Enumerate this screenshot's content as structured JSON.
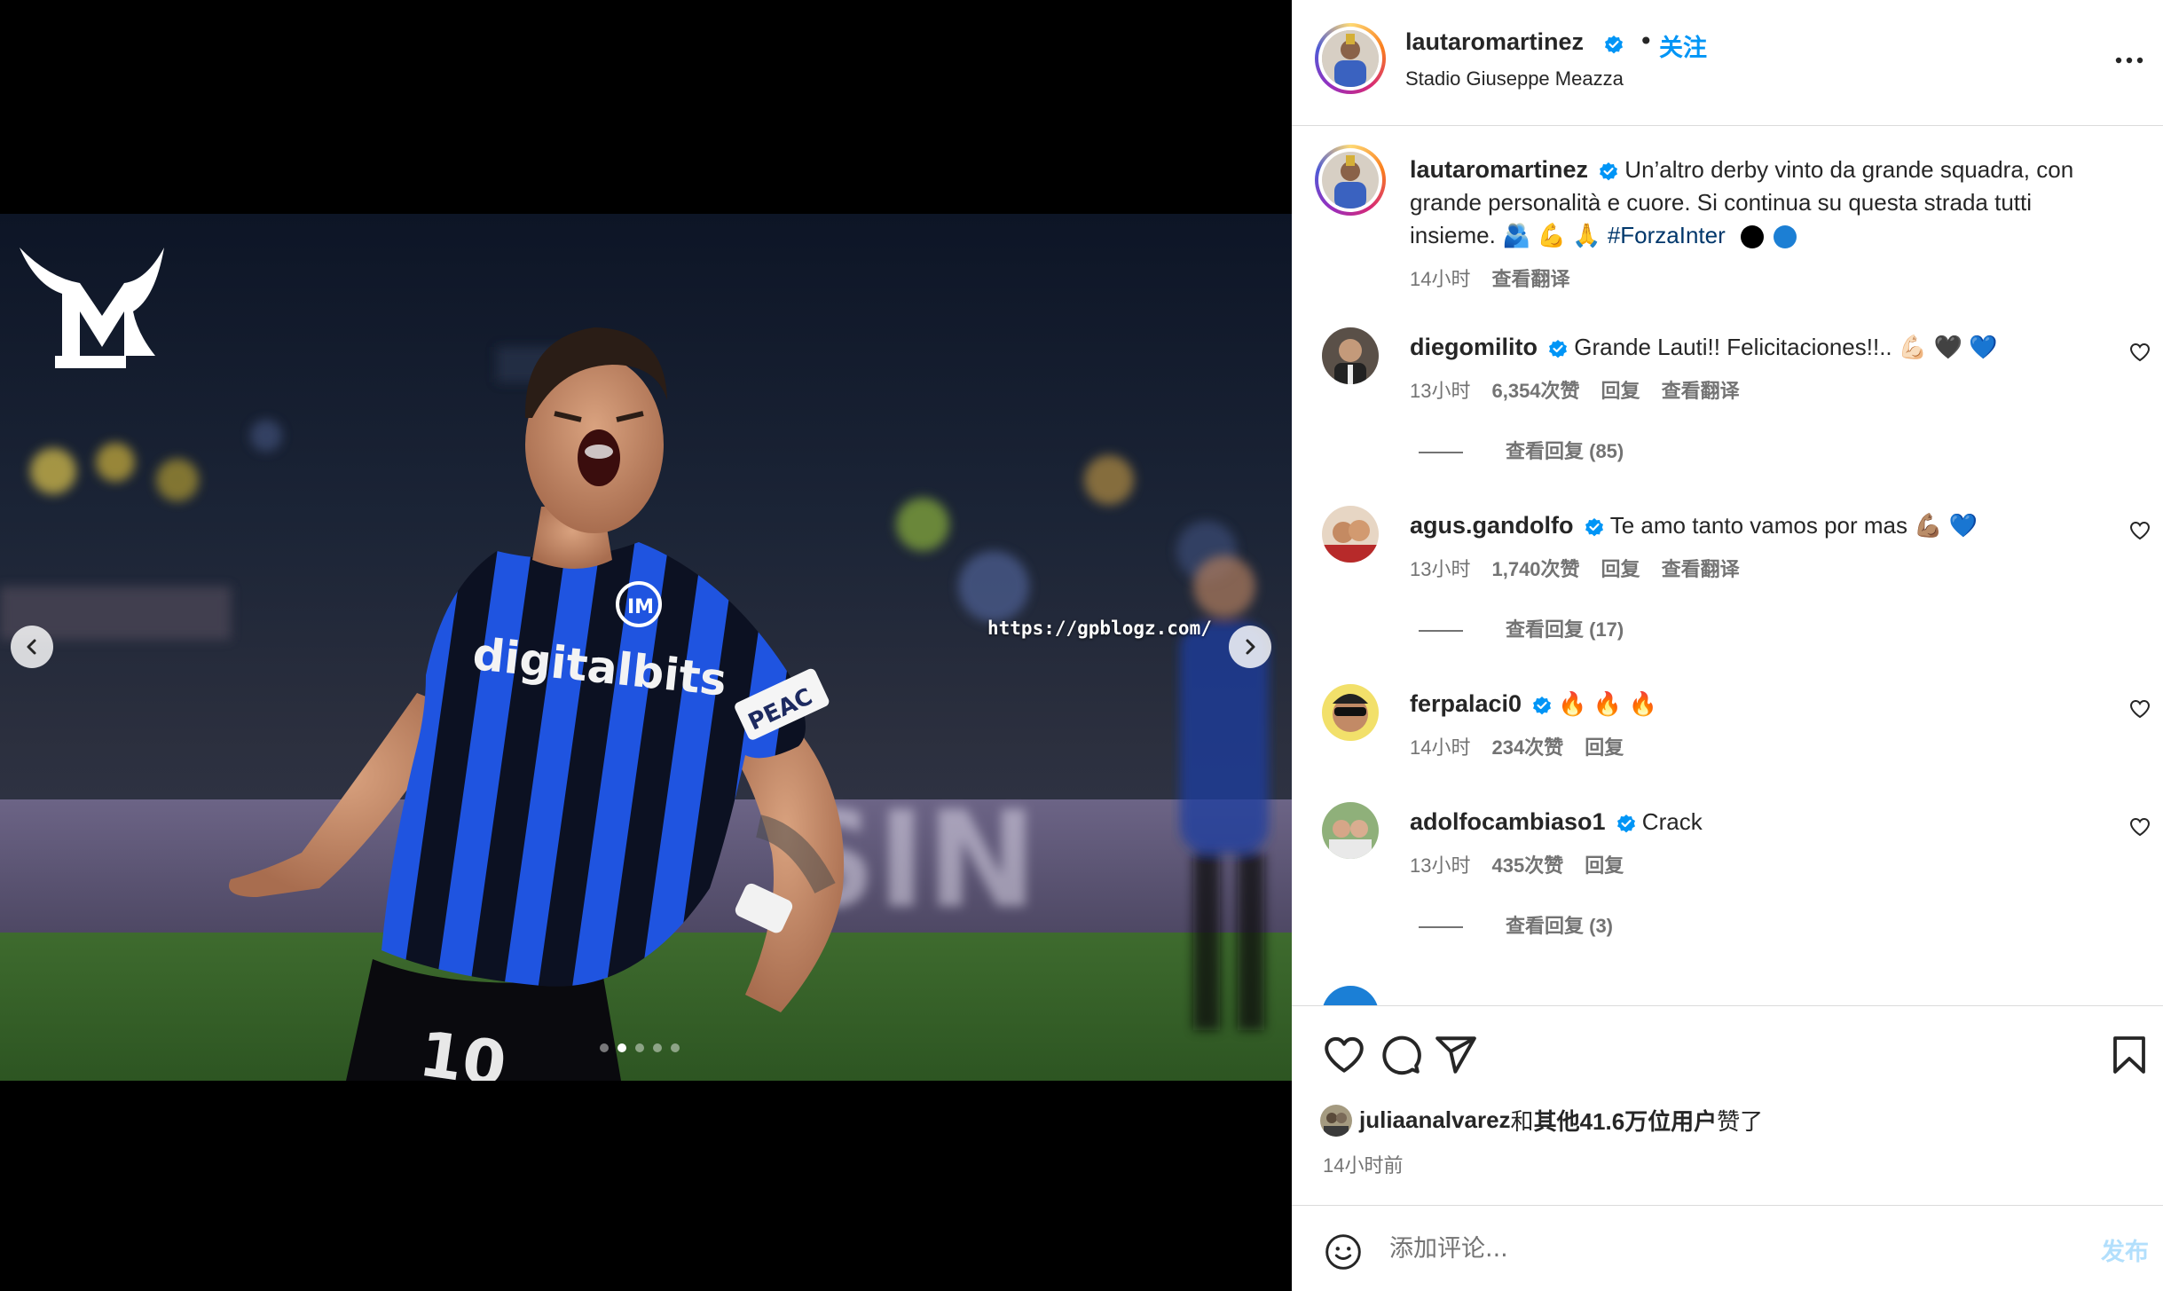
{
  "media": {
    "watermark": "https://gpblogz.com/",
    "slide_count": 5,
    "active_slide": 2,
    "jersey_text": "digitalbits",
    "logo_letters": "ML"
  },
  "header": {
    "username": "lautaromartinez",
    "separator": "•",
    "follow_label": "关注",
    "location": "Stadio Giuseppe Meazza"
  },
  "caption": {
    "username": "lautaromartinez",
    "text_line1": "Un’altro derby vinto da grande squadra, con",
    "text_line2": "grande personalità e cuore. Si continua su questa strada tutti",
    "text_line3_prefix": "insieme. 🫂 💪 🙏 ",
    "hashtag": "#ForzaInter",
    "time": "14小时",
    "translate": "查看翻译"
  },
  "comments": [
    {
      "username": "diegomilito",
      "text": "Grande Lauti!! Felicitaciones!!..",
      "emoji": "💪🏻 🖤 💙",
      "time": "13小时",
      "likes": "6,354次赞",
      "reply": "回复",
      "translate": "查看翻译",
      "view_replies": "查看回复 (85)"
    },
    {
      "username": "agus.gandolfo",
      "text": "Te amo tanto vamos por mas",
      "emoji": "💪🏽 💙",
      "time": "13小时",
      "likes": "1,740次赞",
      "reply": "回复",
      "translate": "查看翻译",
      "view_replies": "查看回复 (17)"
    },
    {
      "username": "ferpalaci0",
      "text": "",
      "emoji": "🔥 🔥 🔥",
      "time": "14小时",
      "likes": "234次赞",
      "reply": "回复"
    },
    {
      "username": "adolfocambiaso1",
      "text": "Crack",
      "emoji": "",
      "time": "13小时",
      "likes": "435次赞",
      "reply": "回复",
      "view_replies": "查看回复 (3)"
    }
  ],
  "actions": {
    "liked_by_user": "juliaanalvarez",
    "liked_by_conj": "和",
    "liked_by_others": "其他41.6万位用户",
    "liked_by_suffix": "赞了",
    "time_ago": "14小时前"
  },
  "comment_box": {
    "placeholder": "添加评论...",
    "post_label": "发布"
  },
  "colors": {
    "accent": "#0095f6",
    "verified": "#0095f6",
    "muted": "#737373",
    "hashtag": "#00376b",
    "post_disabled": "#b2dffc",
    "inter_blue": "#1e4fd8",
    "inter_black": "#0b0f1e"
  }
}
